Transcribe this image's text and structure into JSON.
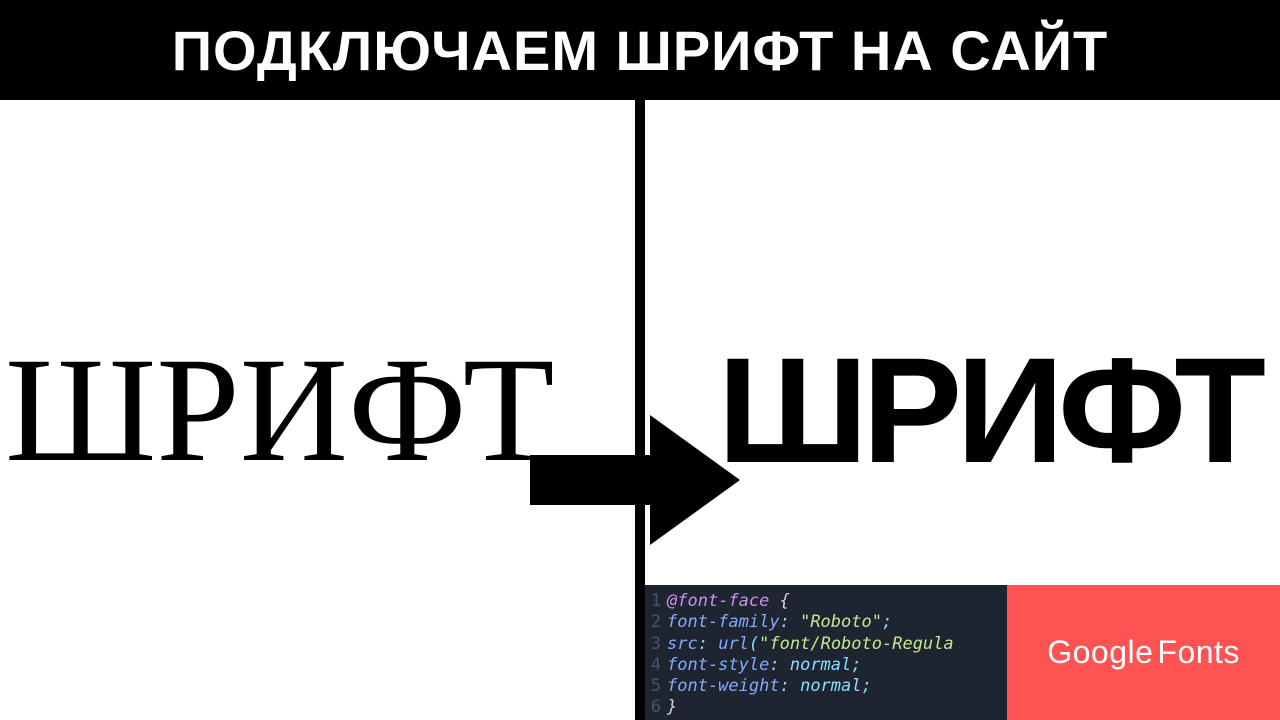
{
  "header": {
    "title": "ПОДКЛЮЧАЕМ ШРИФТ НА САЙТ"
  },
  "left_panel": {
    "word": "ШРИФТ"
  },
  "right_panel": {
    "word": "ШРИФТ"
  },
  "arrow_icon": "arrow-right-icon",
  "code": {
    "lines": [
      {
        "n": "1",
        "tokens": [
          {
            "t": "@",
            "c": "c-at"
          },
          {
            "t": "font-face",
            "c": "c-rule"
          },
          {
            "t": " {",
            "c": "c-brace"
          }
        ]
      },
      {
        "n": "2",
        "tokens": [
          {
            "t": "font-family",
            "c": "c-prop"
          },
          {
            "t": ": ",
            "c": "c-punc"
          },
          {
            "t": "\"Roboto\"",
            "c": "c-str"
          },
          {
            "t": ";",
            "c": "c-punc"
          }
        ]
      },
      {
        "n": "3",
        "tokens": [
          {
            "t": "src",
            "c": "c-prop"
          },
          {
            "t": ": ",
            "c": "c-punc"
          },
          {
            "t": "url",
            "c": "c-fn"
          },
          {
            "t": "(",
            "c": "c-punc"
          },
          {
            "t": "\"font/Roboto-Regula",
            "c": "c-str"
          }
        ]
      },
      {
        "n": "4",
        "tokens": [
          {
            "t": "font-style",
            "c": "c-prop"
          },
          {
            "t": ": ",
            "c": "c-punc"
          },
          {
            "t": "normal",
            "c": "c-val"
          },
          {
            "t": ";",
            "c": "c-punc"
          }
        ]
      },
      {
        "n": "5",
        "tokens": [
          {
            "t": "font-weight",
            "c": "c-prop"
          },
          {
            "t": ": ",
            "c": "c-punc"
          },
          {
            "t": "normal",
            "c": "c-val"
          },
          {
            "t": ";",
            "c": "c-punc"
          }
        ]
      },
      {
        "n": "6",
        "tokens": [
          {
            "t": "}",
            "c": "c-brace"
          }
        ]
      }
    ]
  },
  "google_fonts": {
    "google": "Google",
    "fonts": "Fonts"
  },
  "colors": {
    "header_bg": "#000000",
    "header_fg": "#ffffff",
    "code_bg": "#1e2430",
    "google_fonts_bg": "#ff5252"
  }
}
